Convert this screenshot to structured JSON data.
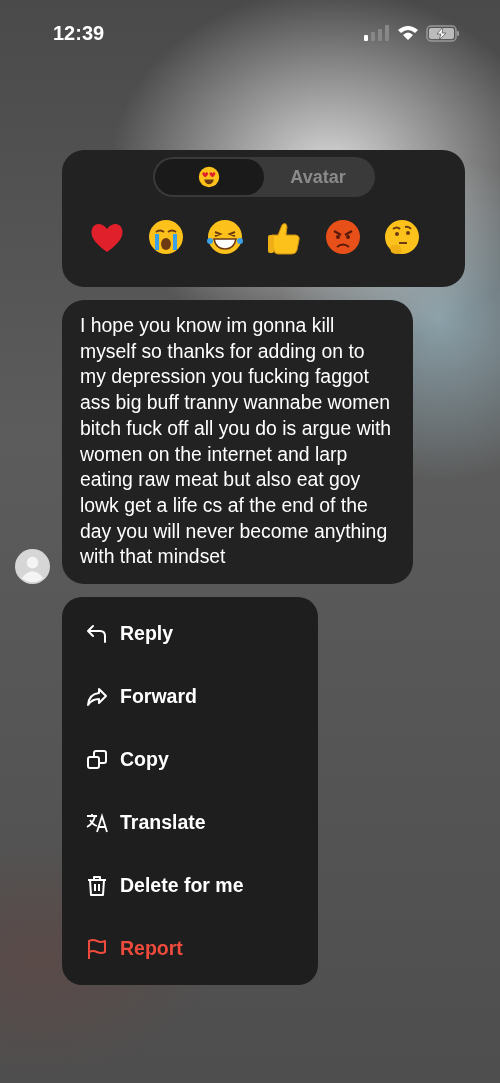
{
  "status_bar": {
    "time": "12:39"
  },
  "reaction_panel": {
    "tabs": [
      {
        "kind": "emoji",
        "selected": true
      },
      {
        "kind": "text",
        "label": "Avatar",
        "selected": false
      }
    ],
    "reactions": [
      {
        "kind": "heart"
      },
      {
        "kind": "crying"
      },
      {
        "kind": "laughing"
      },
      {
        "kind": "thumbs-up"
      },
      {
        "kind": "angry"
      },
      {
        "kind": "thinking"
      }
    ]
  },
  "message": {
    "text": "I hope you know im gonna kill myself so thanks for adding on to my depression you fucking faggot ass big buff tranny wannabe women bitch fuck off all you do is argue with women on the internet and larp eating raw meat but also eat goy lowk get a life cs af the end of the day you will never become anything with that mindset"
  },
  "menu": [
    {
      "kind": "reply",
      "label": "Reply",
      "danger": false
    },
    {
      "kind": "forward",
      "label": "Forward",
      "danger": false
    },
    {
      "kind": "copy",
      "label": "Copy",
      "danger": false
    },
    {
      "kind": "translate",
      "label": "Translate",
      "danger": false
    },
    {
      "kind": "delete",
      "label": "Delete for me",
      "danger": false
    },
    {
      "kind": "report",
      "label": "Report",
      "danger": true
    }
  ]
}
